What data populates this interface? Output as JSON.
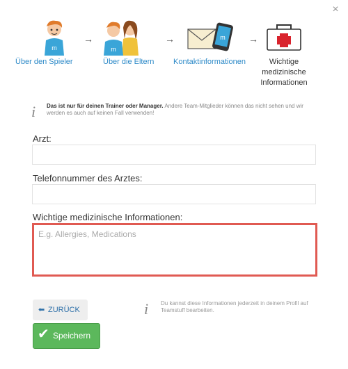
{
  "dialog": {
    "close_icon": "×"
  },
  "steps": [
    {
      "label": "Über den Spieler",
      "icon": "player-icon"
    },
    {
      "label": "Über die Eltern",
      "icon": "parents-icon"
    },
    {
      "label": "Kontaktinformationen",
      "icon": "contact-icon"
    },
    {
      "label_lines": [
        "Wichtige",
        "medizinische",
        "Informationen"
      ],
      "icon": "medical-kit-icon"
    }
  ],
  "notice": {
    "bold": "Das ist nur für deinen Trainer oder Manager.",
    "text": " Andere Team-Mitglieder können das nicht sehen und wir werden es auch auf keinen Fall verwenden!"
  },
  "form": {
    "doctor_label": "Arzt:",
    "doctor_value": "",
    "phone_label": "Telefonnummer des Arztes:",
    "phone_value": "",
    "medical_label": "Wichtige medizinische Informationen:",
    "medical_placeholder": "E.g. Allergies, Medications"
  },
  "buttons": {
    "back_label": "ZURÜCK",
    "save_label": "Speichern"
  },
  "hint": {
    "text": "Du kannst diese Informationen jederzeit in deinem Profil auf Teamstuff bearbeiten."
  },
  "colors": {
    "link": "#2d8ac8",
    "save": "#5cb85c",
    "highlight": "#e05a52"
  }
}
